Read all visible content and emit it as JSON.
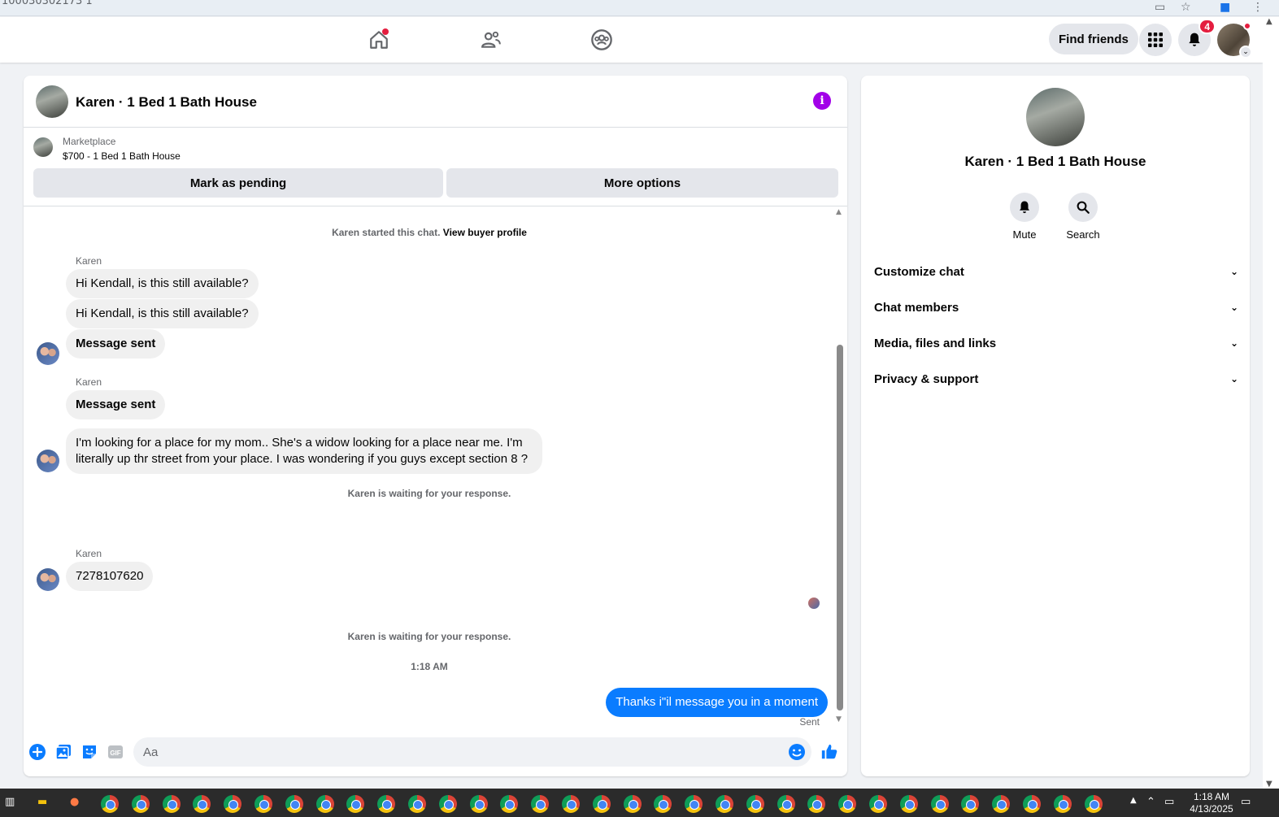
{
  "browser": {
    "url_fragment": "100030302173 1"
  },
  "topnav": {
    "find_friends": "Find friends",
    "notification_count": "4",
    "colors": {
      "badge": "#e41e3f",
      "button_bg": "#e4e6eb"
    }
  },
  "chat": {
    "title": "Karen · 1 Bed 1 Bath House",
    "marketplace_label": "Marketplace",
    "listing": "$700 - 1 Bed 1 Bath House",
    "mark_pending": "Mark as pending",
    "more_options": "More options",
    "started_text": "Karen started this chat.",
    "view_buyer_profile": "View buyer profile",
    "sender_name": "Karen",
    "messages": [
      "Hi Kendall, is this still available?",
      "Hi Kendall, is this still available?",
      "Message sent",
      "Message sent",
      "I'm looking for a place for my mom.. She's a widow looking for a place near me. I'm literally up thr street from your place. I was wondering if you guys except section 8 ?",
      "7278107620"
    ],
    "waiting_text": "Karen is waiting for your response.",
    "timestamp": "1:18 AM",
    "my_message": "Thanks i\"il message you in a moment",
    "sent_label": "Sent",
    "composer_placeholder": "Aa",
    "colors": {
      "my_bubble": "#0a7cff",
      "their_bubble": "#f0f0f0",
      "info": "#a200e8"
    }
  },
  "details": {
    "name": "Karen · 1 Bed 1 Bath House",
    "mute": "Mute",
    "search": "Search",
    "sections": [
      "Customize chat",
      "Chat members",
      "Media, files and links",
      "Privacy & support"
    ]
  },
  "taskbar": {
    "time": "1:18 AM",
    "date": "4/13/2025"
  }
}
